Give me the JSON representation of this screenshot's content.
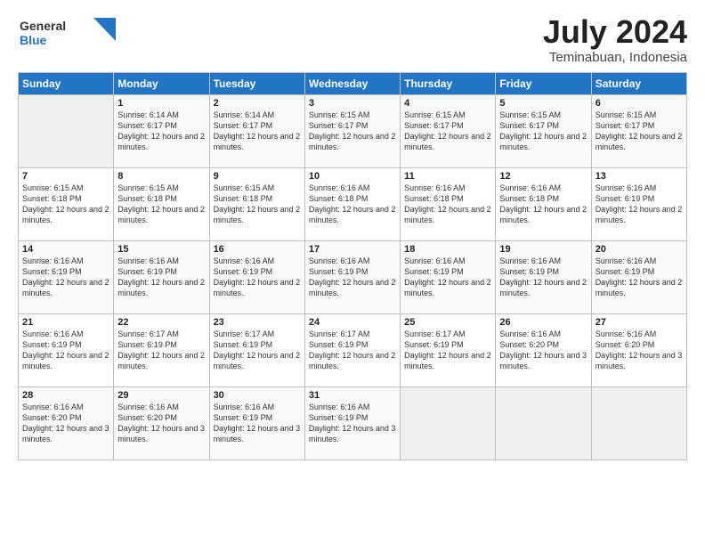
{
  "logo": {
    "general": "General",
    "blue": "Blue"
  },
  "title": {
    "month": "July 2024",
    "location": "Teminabuan, Indonesia"
  },
  "headers": [
    "Sunday",
    "Monday",
    "Tuesday",
    "Wednesday",
    "Thursday",
    "Friday",
    "Saturday"
  ],
  "weeks": [
    [
      {
        "day": "",
        "sunrise": "",
        "sunset": "",
        "daylight": ""
      },
      {
        "day": "1",
        "sunrise": "Sunrise: 6:14 AM",
        "sunset": "Sunset: 6:17 PM",
        "daylight": "Daylight: 12 hours and 2 minutes."
      },
      {
        "day": "2",
        "sunrise": "Sunrise: 6:14 AM",
        "sunset": "Sunset: 6:17 PM",
        "daylight": "Daylight: 12 hours and 2 minutes."
      },
      {
        "day": "3",
        "sunrise": "Sunrise: 6:15 AM",
        "sunset": "Sunset: 6:17 PM",
        "daylight": "Daylight: 12 hours and 2 minutes."
      },
      {
        "day": "4",
        "sunrise": "Sunrise: 6:15 AM",
        "sunset": "Sunset: 6:17 PM",
        "daylight": "Daylight: 12 hours and 2 minutes."
      },
      {
        "day": "5",
        "sunrise": "Sunrise: 6:15 AM",
        "sunset": "Sunset: 6:17 PM",
        "daylight": "Daylight: 12 hours and 2 minutes."
      },
      {
        "day": "6",
        "sunrise": "Sunrise: 6:15 AM",
        "sunset": "Sunset: 6:17 PM",
        "daylight": "Daylight: 12 hours and 2 minutes."
      }
    ],
    [
      {
        "day": "7",
        "sunrise": "Sunrise: 6:15 AM",
        "sunset": "Sunset: 6:18 PM",
        "daylight": "Daylight: 12 hours and 2 minutes."
      },
      {
        "day": "8",
        "sunrise": "Sunrise: 6:15 AM",
        "sunset": "Sunset: 6:18 PM",
        "daylight": "Daylight: 12 hours and 2 minutes."
      },
      {
        "day": "9",
        "sunrise": "Sunrise: 6:15 AM",
        "sunset": "Sunset: 6:18 PM",
        "daylight": "Daylight: 12 hours and 2 minutes."
      },
      {
        "day": "10",
        "sunrise": "Sunrise: 6:16 AM",
        "sunset": "Sunset: 6:18 PM",
        "daylight": "Daylight: 12 hours and 2 minutes."
      },
      {
        "day": "11",
        "sunrise": "Sunrise: 6:16 AM",
        "sunset": "Sunset: 6:18 PM",
        "daylight": "Daylight: 12 hours and 2 minutes."
      },
      {
        "day": "12",
        "sunrise": "Sunrise: 6:16 AM",
        "sunset": "Sunset: 6:18 PM",
        "daylight": "Daylight: 12 hours and 2 minutes."
      },
      {
        "day": "13",
        "sunrise": "Sunrise: 6:16 AM",
        "sunset": "Sunset: 6:19 PM",
        "daylight": "Daylight: 12 hours and 2 minutes."
      }
    ],
    [
      {
        "day": "14",
        "sunrise": "Sunrise: 6:16 AM",
        "sunset": "Sunset: 6:19 PM",
        "daylight": "Daylight: 12 hours and 2 minutes."
      },
      {
        "day": "15",
        "sunrise": "Sunrise: 6:16 AM",
        "sunset": "Sunset: 6:19 PM",
        "daylight": "Daylight: 12 hours and 2 minutes."
      },
      {
        "day": "16",
        "sunrise": "Sunrise: 6:16 AM",
        "sunset": "Sunset: 6:19 PM",
        "daylight": "Daylight: 12 hours and 2 minutes."
      },
      {
        "day": "17",
        "sunrise": "Sunrise: 6:16 AM",
        "sunset": "Sunset: 6:19 PM",
        "daylight": "Daylight: 12 hours and 2 minutes."
      },
      {
        "day": "18",
        "sunrise": "Sunrise: 6:16 AM",
        "sunset": "Sunset: 6:19 PM",
        "daylight": "Daylight: 12 hours and 2 minutes."
      },
      {
        "day": "19",
        "sunrise": "Sunrise: 6:16 AM",
        "sunset": "Sunset: 6:19 PM",
        "daylight": "Daylight: 12 hours and 2 minutes."
      },
      {
        "day": "20",
        "sunrise": "Sunrise: 6:16 AM",
        "sunset": "Sunset: 6:19 PM",
        "daylight": "Daylight: 12 hours and 2 minutes."
      }
    ],
    [
      {
        "day": "21",
        "sunrise": "Sunrise: 6:16 AM",
        "sunset": "Sunset: 6:19 PM",
        "daylight": "Daylight: 12 hours and 2 minutes."
      },
      {
        "day": "22",
        "sunrise": "Sunrise: 6:17 AM",
        "sunset": "Sunset: 6:19 PM",
        "daylight": "Daylight: 12 hours and 2 minutes."
      },
      {
        "day": "23",
        "sunrise": "Sunrise: 6:17 AM",
        "sunset": "Sunset: 6:19 PM",
        "daylight": "Daylight: 12 hours and 2 minutes."
      },
      {
        "day": "24",
        "sunrise": "Sunrise: 6:17 AM",
        "sunset": "Sunset: 6:19 PM",
        "daylight": "Daylight: 12 hours and 2 minutes."
      },
      {
        "day": "25",
        "sunrise": "Sunrise: 6:17 AM",
        "sunset": "Sunset: 6:19 PM",
        "daylight": "Daylight: 12 hours and 2 minutes."
      },
      {
        "day": "26",
        "sunrise": "Sunrise: 6:16 AM",
        "sunset": "Sunset: 6:20 PM",
        "daylight": "Daylight: 12 hours and 3 minutes."
      },
      {
        "day": "27",
        "sunrise": "Sunrise: 6:16 AM",
        "sunset": "Sunset: 6:20 PM",
        "daylight": "Daylight: 12 hours and 3 minutes."
      }
    ],
    [
      {
        "day": "28",
        "sunrise": "Sunrise: 6:16 AM",
        "sunset": "Sunset: 6:20 PM",
        "daylight": "Daylight: 12 hours and 3 minutes."
      },
      {
        "day": "29",
        "sunrise": "Sunrise: 6:16 AM",
        "sunset": "Sunset: 6:20 PM",
        "daylight": "Daylight: 12 hours and 3 minutes."
      },
      {
        "day": "30",
        "sunrise": "Sunrise: 6:16 AM",
        "sunset": "Sunset: 6:19 PM",
        "daylight": "Daylight: 12 hours and 3 minutes."
      },
      {
        "day": "31",
        "sunrise": "Sunrise: 6:16 AM",
        "sunset": "Sunset: 6:19 PM",
        "daylight": "Daylight: 12 hours and 3 minutes."
      },
      {
        "day": "",
        "sunrise": "",
        "sunset": "",
        "daylight": ""
      },
      {
        "day": "",
        "sunrise": "",
        "sunset": "",
        "daylight": ""
      },
      {
        "day": "",
        "sunrise": "",
        "sunset": "",
        "daylight": ""
      }
    ]
  ]
}
